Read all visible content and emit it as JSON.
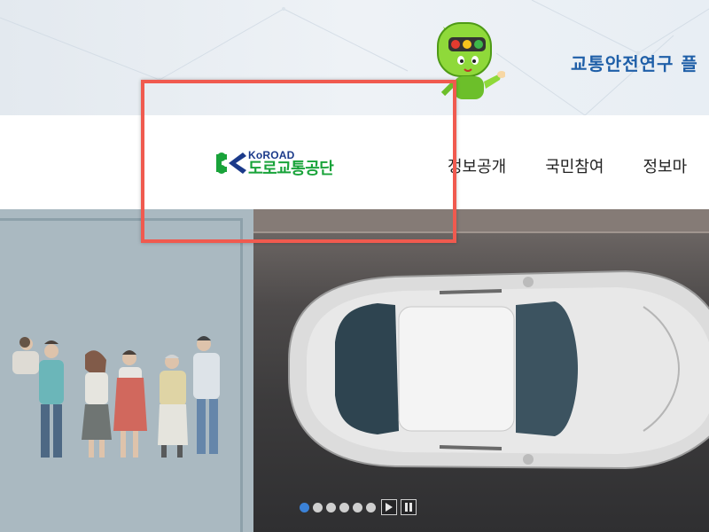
{
  "banner": {
    "text": "교통안전연구 플",
    "mascot": "traffic-light-mascot"
  },
  "logo": {
    "en": "KoROAD",
    "ko": "도로교통공단",
    "colors": {
      "green": "#19a33a",
      "navy": "#1b3a8a"
    }
  },
  "nav": {
    "items": [
      {
        "label": "정보공개"
      },
      {
        "label": "국민참여"
      },
      {
        "label": "정보마"
      }
    ]
  },
  "hero": {
    "slides_total": 6,
    "active_slide": 1,
    "play_icon": "play-icon",
    "pause_icon": "pause-icon"
  },
  "colors": {
    "highlight": "#f05a4f",
    "accent": "#3b82d8",
    "banner_text": "#1f5fa8"
  }
}
